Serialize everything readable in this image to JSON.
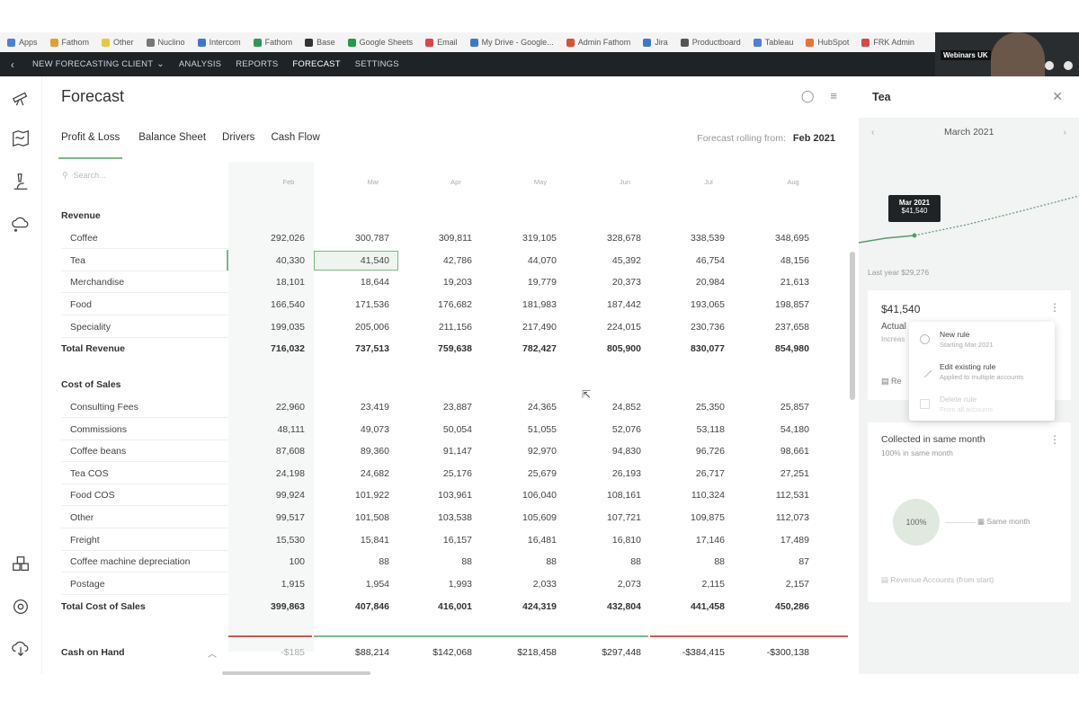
{
  "bookmarks": [
    "Apps",
    "Fathom",
    "Other",
    "Nuclino",
    "Intercom",
    "Fathom",
    "Base",
    "Google Sheets",
    "Email",
    "My Drive - Google...",
    "Admin Fathom",
    "Jira",
    "Productboard",
    "Tableau",
    "HubSpot",
    "FRK Admin"
  ],
  "topbar": {
    "client": "NEW FORECASTING CLIENT",
    "items": [
      "ANALYSIS",
      "REPORTS",
      "FORECAST",
      "SETTINGS"
    ],
    "active": "FORECAST",
    "webcam_label": "Webinars UK"
  },
  "page": {
    "title": "Forecast",
    "tabs": [
      "Profit & Loss",
      "Balance Sheet",
      "Drivers",
      "Cash Flow"
    ],
    "rolling_label": "Forecast rolling from:",
    "rolling_value": "Feb 2021",
    "search_placeholder": "Search..."
  },
  "months": [
    "Feb",
    "Mar",
    "Apr",
    "May",
    "Jun",
    "Jul",
    "Aug"
  ],
  "revenue": {
    "title": "Revenue",
    "rows": [
      {
        "label": "Coffee",
        "values": [
          "292,026",
          "300,787",
          "309,811",
          "319,105",
          "328,678",
          "338,539",
          "348,695"
        ]
      },
      {
        "label": "Tea",
        "values": [
          "40,330",
          "41,540",
          "42,786",
          "44,070",
          "45,392",
          "46,754",
          "48,156"
        ]
      },
      {
        "label": "Merchandise",
        "values": [
          "18,101",
          "18,644",
          "19,203",
          "19,779",
          "20,373",
          "20,984",
          "21,613"
        ]
      },
      {
        "label": "Food",
        "values": [
          "166,540",
          "171,536",
          "176,682",
          "181,983",
          "187,442",
          "193,065",
          "198,857"
        ]
      },
      {
        "label": "Speciality",
        "values": [
          "199,035",
          "205,006",
          "211,156",
          "217,490",
          "224,015",
          "230,736",
          "237,658"
        ]
      }
    ],
    "total": {
      "label": "Total Revenue",
      "values": [
        "716,032",
        "737,513",
        "759,638",
        "782,427",
        "805,900",
        "830,077",
        "854,980"
      ]
    }
  },
  "cost_of_sales": {
    "title": "Cost of Sales",
    "rows": [
      {
        "label": "Consulting Fees",
        "values": [
          "22,960",
          "23,419",
          "23,887",
          "24,365",
          "24,852",
          "25,350",
          "25,857"
        ]
      },
      {
        "label": "Commissions",
        "values": [
          "48,111",
          "49,073",
          "50,054",
          "51,055",
          "52,076",
          "53,118",
          "54,180"
        ]
      },
      {
        "label": "Coffee beans",
        "values": [
          "87,608",
          "89,360",
          "91,147",
          "92,970",
          "94,830",
          "96,726",
          "98,661"
        ]
      },
      {
        "label": "Tea COS",
        "values": [
          "24,198",
          "24,682",
          "25,176",
          "25,679",
          "26,193",
          "26,717",
          "27,251"
        ]
      },
      {
        "label": "Food COS",
        "values": [
          "99,924",
          "101,922",
          "103,961",
          "106,040",
          "108,161",
          "110,324",
          "112,531"
        ]
      },
      {
        "label": "Other",
        "values": [
          "99,517",
          "101,508",
          "103,538",
          "105,609",
          "107,721",
          "109,875",
          "112,073"
        ]
      },
      {
        "label": "Freight",
        "values": [
          "15,530",
          "15,841",
          "16,157",
          "16,481",
          "16,810",
          "17,146",
          "17,489"
        ]
      },
      {
        "label": "Coffee machine depreciation",
        "values": [
          "100",
          "88",
          "88",
          "88",
          "88",
          "88",
          "87"
        ]
      },
      {
        "label": "Postage",
        "values": [
          "1,915",
          "1,954",
          "1,993",
          "2,033",
          "2,073",
          "2,115",
          "2,157"
        ]
      }
    ],
    "total": {
      "label": "Total Cost of Sales",
      "values": [
        "399,863",
        "407,846",
        "416,001",
        "424,319",
        "432,804",
        "441,458",
        "450,286"
      ]
    }
  },
  "cash": {
    "label": "Cash on Hand",
    "values": [
      "-$185",
      "$88,214",
      "$142,068",
      "$218,458",
      "$297,448",
      "-$384,415",
      "-$300,138"
    ],
    "positive_color": "#7ab88a",
    "negative_color": "#d9534f"
  },
  "side": {
    "title": "Tea",
    "month": "March 2021",
    "tooltip_month": "Mar 2021",
    "tooltip_value": "$41,540",
    "last_year": "Last year $29,276",
    "card1": {
      "amount": "$41,540",
      "subtitle": "Actual",
      "subtitle2": "Increas",
      "footer": "Re"
    },
    "menu": [
      {
        "title": "New rule",
        "sub": "Starting Mar 2021"
      },
      {
        "title": "Edit existing rule",
        "sub": "Applied to multiple accounts"
      },
      {
        "title": "Delete rule",
        "sub": "From all accounts"
      }
    ],
    "card2": {
      "title": "Collected in same month",
      "sub": "100% in same month",
      "donut": "100%",
      "same_month": "Same month",
      "rev_accounts": "Revenue Accounts",
      "rev_accounts_note": "(from start)"
    }
  }
}
